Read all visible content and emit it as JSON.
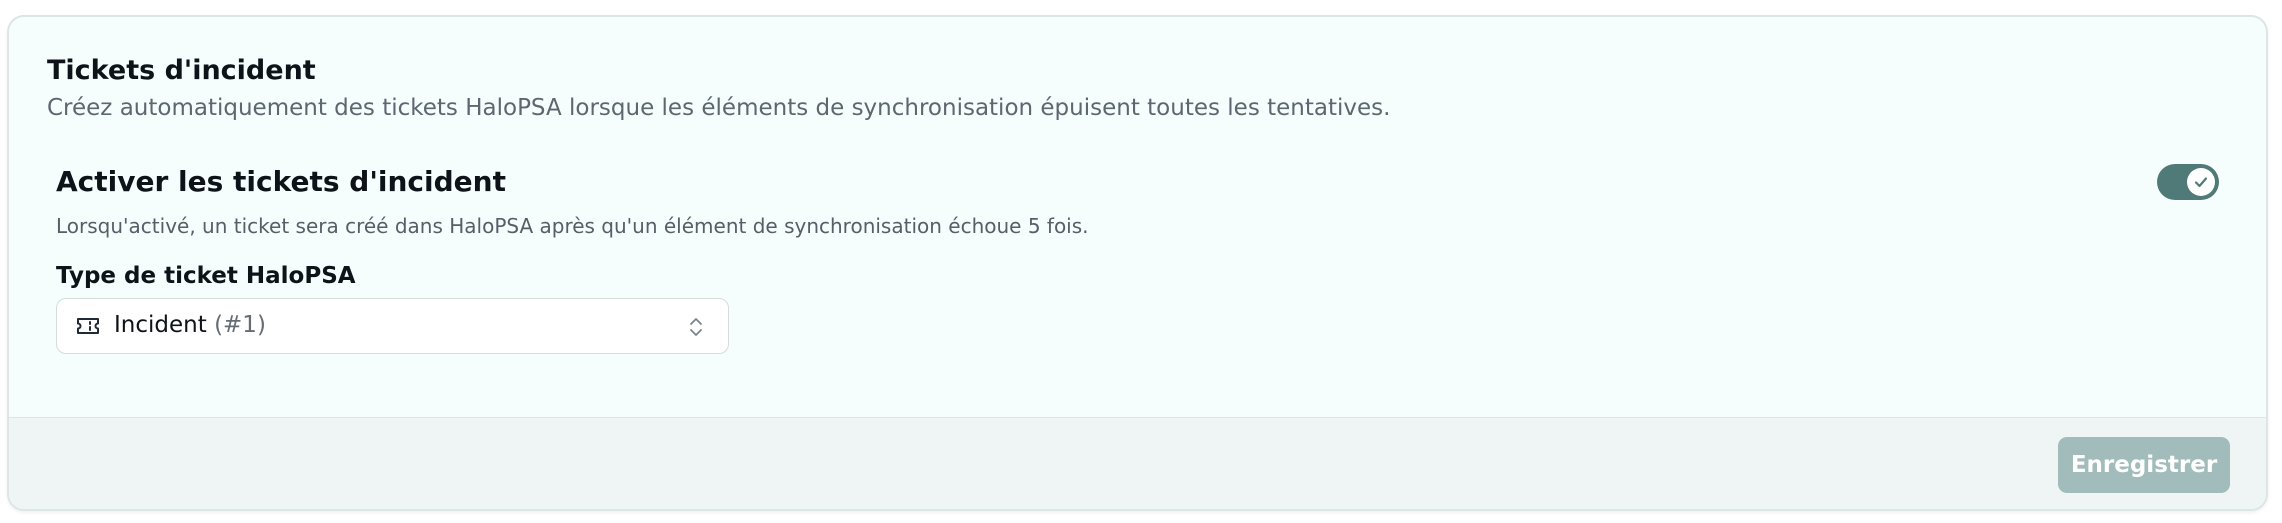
{
  "card": {
    "title": "Tickets d'incident",
    "description": "Créez automatiquement des tickets HaloPSA lorsque les éléments de synchronisation épuisent toutes les tentatives."
  },
  "setting": {
    "title": "Activer les tickets d'incident",
    "description": "Lorsqu'activé, un ticket sera créé dans HaloPSA après qu'un élément de synchronisation échoue 5 fois.",
    "enabled": true,
    "toggle_color": "#507a78"
  },
  "ticket_type": {
    "label": "Type de ticket HaloPSA",
    "selected_value": "Incident",
    "selected_id": "(#1)",
    "icon": "ticket-icon"
  },
  "footer": {
    "save_label": "Enregistrer",
    "save_color": "#a1bcbb"
  }
}
